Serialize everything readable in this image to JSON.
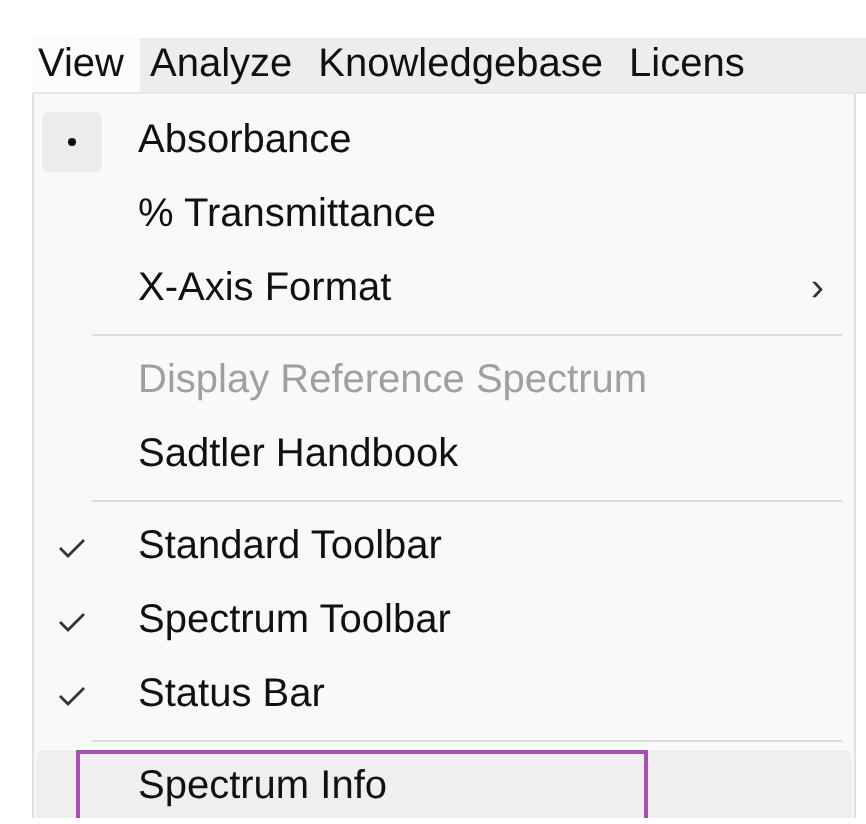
{
  "menu_bar": [
    {
      "label": "View",
      "selected": true
    },
    {
      "label": "Analyze",
      "selected": false
    },
    {
      "label": "Knowledgebase",
      "selected": false
    },
    {
      "label": "Licens",
      "selected": false
    }
  ],
  "menu": [
    {
      "kind": "radio",
      "label": "Absorbance",
      "selected": true
    },
    {
      "kind": "radio",
      "label": "% Transmittance",
      "selected": false
    },
    {
      "kind": "submenu",
      "label": "X-Axis Format",
      "arrow": "›"
    },
    {
      "kind": "separator"
    },
    {
      "kind": "plain",
      "label": "Display Reference Spectrum",
      "disabled": true
    },
    {
      "kind": "plain",
      "label": "Sadtler Handbook",
      "disabled": false
    },
    {
      "kind": "separator"
    },
    {
      "kind": "check",
      "label": "Standard Toolbar",
      "checked": true
    },
    {
      "kind": "check",
      "label": "Spectrum Toolbar",
      "checked": true
    },
    {
      "kind": "check",
      "label": "Status Bar",
      "checked": true
    },
    {
      "kind": "separator"
    },
    {
      "kind": "plain",
      "label": "Spectrum Info",
      "disabled": false,
      "highlighted": true,
      "outlined": true
    }
  ]
}
